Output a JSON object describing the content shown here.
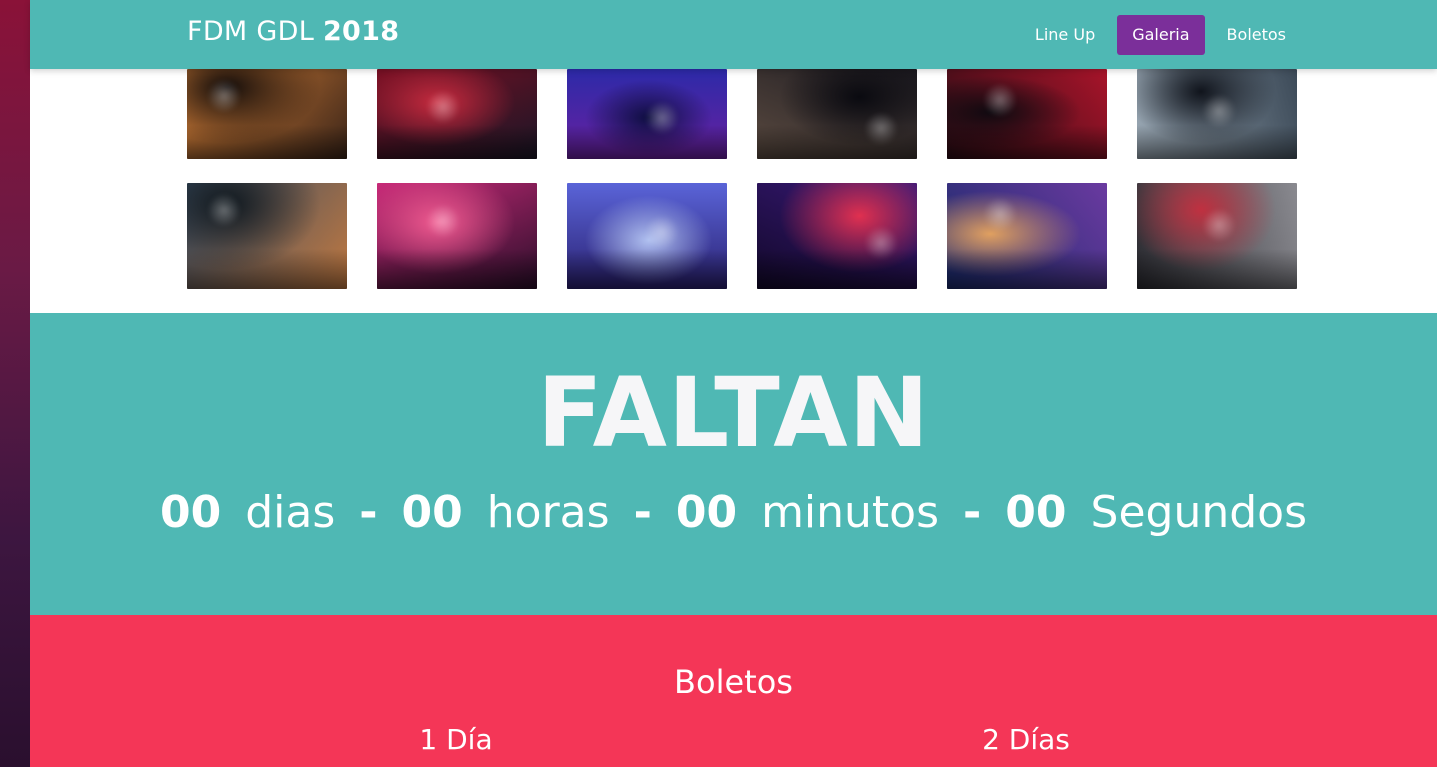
{
  "brand": {
    "name": "FDM GDL",
    "year": "2018"
  },
  "nav": {
    "items": [
      {
        "label": "Line Up",
        "active": false
      },
      {
        "label": "Galeria",
        "active": true
      },
      {
        "label": "Boletos",
        "active": false
      }
    ]
  },
  "gallery": {
    "row1": [
      {
        "name": "concert-crowd-photo",
        "colors": [
          "#e0863a",
          "#3a2418",
          "#120c0a"
        ]
      },
      {
        "name": "singer-stage-photo",
        "colors": [
          "#7a1024",
          "#1a1626",
          "#c62a3e"
        ]
      },
      {
        "name": "festival-lights-photo",
        "colors": [
          "#2c2aa8",
          "#6a20a0",
          "#0e0e40"
        ]
      },
      {
        "name": "dj-turntable-photo",
        "colors": [
          "#1c1a20",
          "#5a4a40",
          "#0a0a10"
        ]
      },
      {
        "name": "guitarist-red-photo",
        "colors": [
          "#a8142a",
          "#2a0c14",
          "#100a10"
        ]
      },
      {
        "name": "dj-headphones-photo",
        "colors": [
          "#3c4a58",
          "#9aa8b4",
          "#10141c"
        ]
      }
    ],
    "row2": [
      {
        "name": "guitar-players-photo",
        "colors": [
          "#3a4e64",
          "#c07840",
          "#10181e"
        ]
      },
      {
        "name": "dj-laptop-photo",
        "colors": [
          "#c82a78",
          "#2a0e2a",
          "#f05a90"
        ]
      },
      {
        "name": "dj-mixer-blue-photo",
        "colors": [
          "#5a64d8",
          "#2a2070",
          "#b0c0f0"
        ]
      },
      {
        "name": "dj-controller-purple-photo",
        "colors": [
          "#3a1a7a",
          "#12082a",
          "#e03050"
        ]
      },
      {
        "name": "band-performance-photo",
        "colors": [
          "#6a3aa0",
          "#1a2a6a",
          "#e0a060"
        ]
      },
      {
        "name": "smoke-performer-photo",
        "colors": [
          "#8a8a90",
          "#2a2a30",
          "#c03040"
        ]
      }
    ]
  },
  "countdown": {
    "heading": "FALTAN",
    "days": "00",
    "days_label": "dias",
    "hours": "00",
    "hours_label": "horas",
    "minutes": "00",
    "minutes_label": "minutos",
    "seconds": "00",
    "seconds_label": "Segundos",
    "separator": "-"
  },
  "tickets": {
    "title": "Boletos",
    "options": [
      {
        "label": "1 Día"
      },
      {
        "label": "2 Días"
      }
    ]
  },
  "colors": {
    "teal": "#4fb8b4",
    "purple_active": "#7b2f9a",
    "tickets_red": "#f43657"
  }
}
